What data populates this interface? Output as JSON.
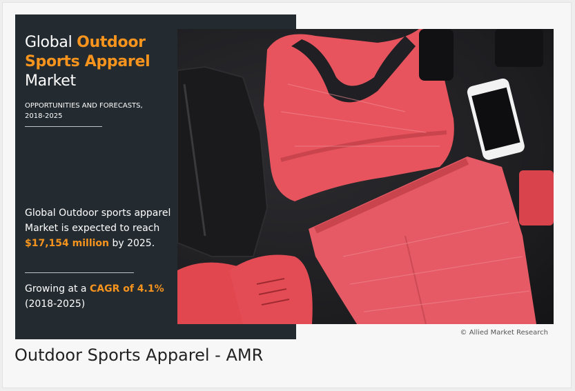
{
  "infographic": {
    "title_line1_plain": "Global ",
    "title_line1_highlight": "Outdoor",
    "title_line2_highlight": "Sports Apparel",
    "title_line3_plain": "Market",
    "subtitle_line1": "OPPORTUNITIES AND FORECASTS,",
    "subtitle_line2": "2018-2025",
    "stat1_text_a": "Global Outdoor sports apparel Market is expected to reach ",
    "stat1_highlight": "$17,154 million",
    "stat1_text_b": " by 2025.",
    "stat2_text_a": "Growing at a ",
    "stat2_highlight": "CAGR of 4.1%",
    "stat2_text_b": "(2018-2025)",
    "copyright": "© Allied Market Research"
  },
  "caption": "Outdoor Sports Apparel - AMR",
  "colors": {
    "panel": "#232b31",
    "accent": "#f7941d",
    "apparel": "#e8545e"
  }
}
